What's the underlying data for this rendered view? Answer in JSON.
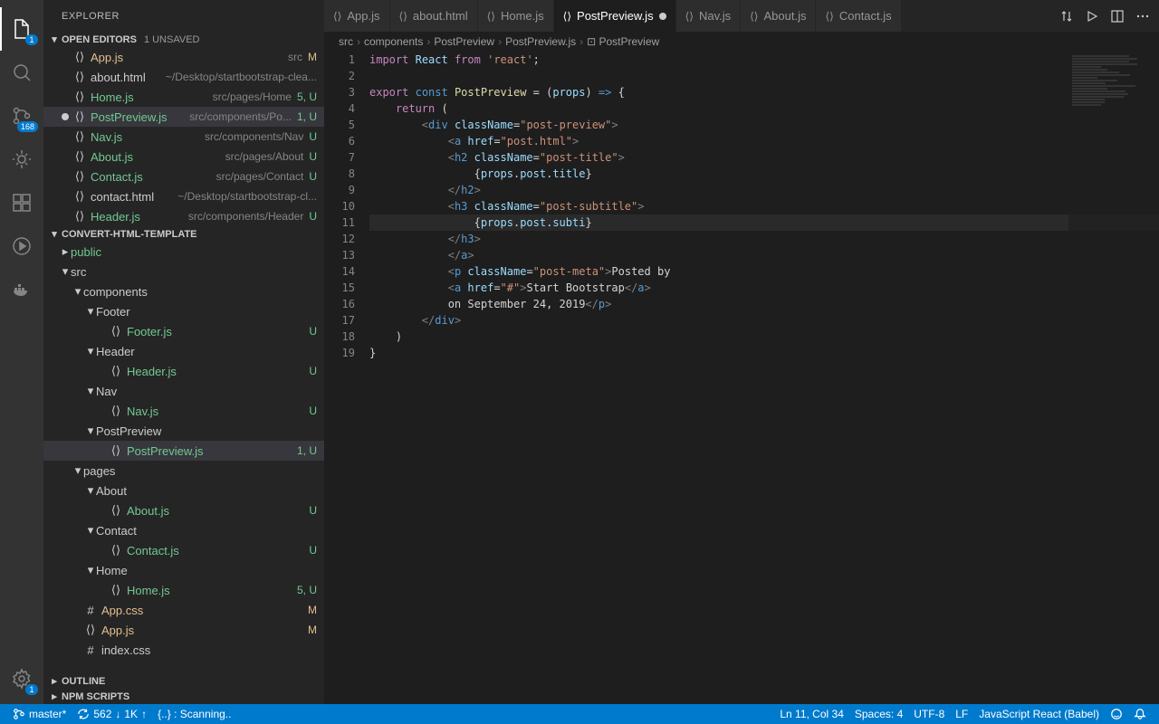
{
  "sidebar": {
    "title": "EXPLORER",
    "openEditors": {
      "label": "OPEN EDITORS",
      "unsaved": "1 UNSAVED",
      "items": [
        {
          "name": "App.js",
          "hint": "src",
          "status": "M",
          "git": "m"
        },
        {
          "name": "about.html",
          "hint": "~/Desktop/startbootstrap-clea...",
          "status": "",
          "git": ""
        },
        {
          "name": "Home.js",
          "hint": "src/pages/Home",
          "status": "5, U",
          "git": "u"
        },
        {
          "name": "PostPreview.js",
          "hint": "src/components/Po...",
          "status": "1, U",
          "git": "u",
          "dirty": true,
          "selected": true
        },
        {
          "name": "Nav.js",
          "hint": "src/components/Nav",
          "status": "U",
          "git": "u"
        },
        {
          "name": "About.js",
          "hint": "src/pages/About",
          "status": "U",
          "git": "u"
        },
        {
          "name": "Contact.js",
          "hint": "src/pages/Contact",
          "status": "U",
          "git": "u"
        },
        {
          "name": "contact.html",
          "hint": "~/Desktop/startbootstrap-cl...",
          "status": "",
          "git": ""
        },
        {
          "name": "Header.js",
          "hint": "src/components/Header",
          "status": "U",
          "git": "u"
        }
      ]
    },
    "project": {
      "label": "CONVERT-HTML-TEMPLATE"
    },
    "outline": "OUTLINE",
    "npm": "NPM SCRIPTS"
  },
  "activity": {
    "explorerBadge": "1",
    "scmBadge": "168",
    "gearBadge": "1"
  },
  "tree": [
    {
      "type": "folder",
      "name": "public",
      "depth": 1,
      "open": false,
      "git": "u",
      "dot": "u"
    },
    {
      "type": "folder",
      "name": "src",
      "depth": 1,
      "open": true,
      "git": "",
      "dot": "m"
    },
    {
      "type": "folder",
      "name": "components",
      "depth": 2,
      "open": true,
      "git": "",
      "dot": "u"
    },
    {
      "type": "folder",
      "name": "Footer",
      "depth": 3,
      "open": true,
      "git": "",
      "dot": "u"
    },
    {
      "type": "file",
      "name": "Footer.js",
      "depth": 4,
      "status": "U",
      "git": "u"
    },
    {
      "type": "folder",
      "name": "Header",
      "depth": 3,
      "open": true,
      "git": "",
      "dot": "u"
    },
    {
      "type": "file",
      "name": "Header.js",
      "depth": 4,
      "status": "U",
      "git": "u"
    },
    {
      "type": "folder",
      "name": "Nav",
      "depth": 3,
      "open": true,
      "git": "",
      "dot": "u"
    },
    {
      "type": "file",
      "name": "Nav.js",
      "depth": 4,
      "status": "U",
      "git": "u"
    },
    {
      "type": "folder",
      "name": "PostPreview",
      "depth": 3,
      "open": true,
      "git": "",
      "dot": "u"
    },
    {
      "type": "file",
      "name": "PostPreview.js",
      "depth": 4,
      "status": "1, U",
      "git": "u",
      "selected": true
    },
    {
      "type": "folder",
      "name": "pages",
      "depth": 2,
      "open": true,
      "git": "",
      "dot": "u"
    },
    {
      "type": "folder",
      "name": "About",
      "depth": 3,
      "open": true,
      "git": "",
      "dot": "u"
    },
    {
      "type": "file",
      "name": "About.js",
      "depth": 4,
      "status": "U",
      "git": "u"
    },
    {
      "type": "folder",
      "name": "Contact",
      "depth": 3,
      "open": true,
      "git": "",
      "dot": "u"
    },
    {
      "type": "file",
      "name": "Contact.js",
      "depth": 4,
      "status": "U",
      "git": "u"
    },
    {
      "type": "folder",
      "name": "Home",
      "depth": 3,
      "open": true,
      "git": "",
      "dot": "u"
    },
    {
      "type": "file",
      "name": "Home.js",
      "depth": 4,
      "status": "5, U",
      "git": "u"
    },
    {
      "type": "file",
      "name": "App.css",
      "depth": 2,
      "status": "M",
      "git": "m",
      "icon": "#"
    },
    {
      "type": "file",
      "name": "App.js",
      "depth": 2,
      "status": "M",
      "git": "m"
    },
    {
      "type": "file",
      "name": "index.css",
      "depth": 2,
      "status": "",
      "git": "",
      "icon": "#"
    }
  ],
  "tabs": [
    {
      "label": "App.js",
      "active": false
    },
    {
      "label": "about.html",
      "active": false
    },
    {
      "label": "Home.js",
      "active": false
    },
    {
      "label": "PostPreview.js",
      "active": true,
      "dirty": true
    },
    {
      "label": "Nav.js",
      "active": false
    },
    {
      "label": "About.js",
      "active": false
    },
    {
      "label": "Contact.js",
      "active": false
    }
  ],
  "breadcrumbs": [
    "src",
    "components",
    "PostPreview",
    "PostPreview.js",
    "PostPreview"
  ],
  "code": {
    "lines": 19
  },
  "statusBar": {
    "branch": "master*",
    "sync1": "562",
    "sync2": "1K",
    "scan": "{..} : Scanning..",
    "pos": "Ln 11, Col 34",
    "spaces": "Spaces: 4",
    "encoding": "UTF-8",
    "eol": "LF",
    "lang": "JavaScript React (Babel)"
  }
}
